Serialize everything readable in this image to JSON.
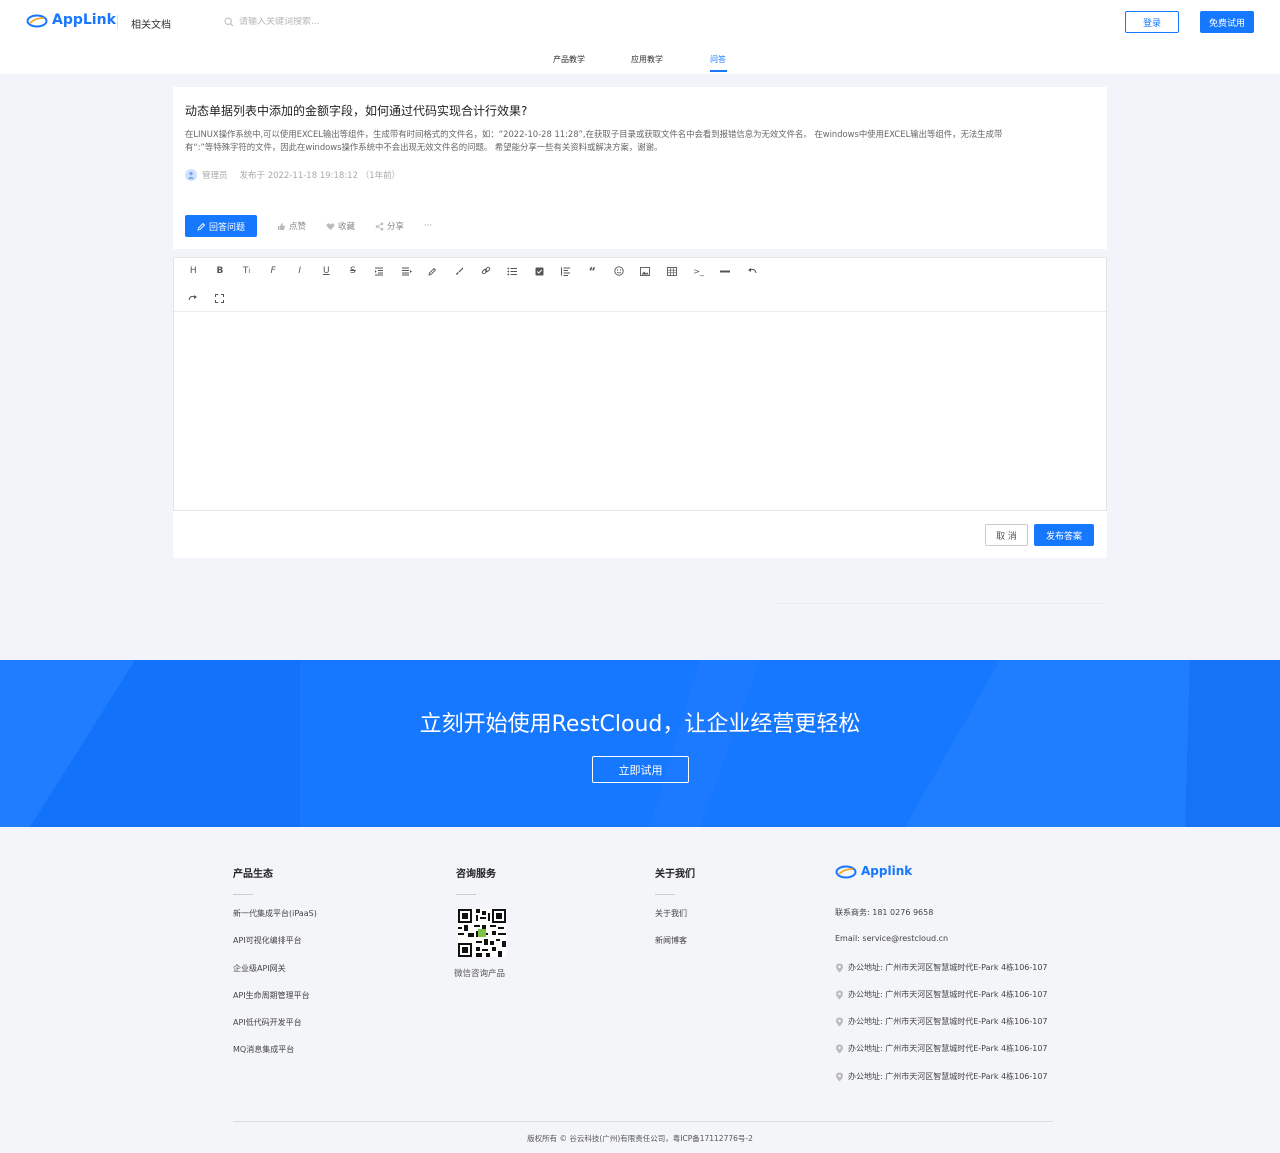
{
  "header": {
    "brand": "AppLink",
    "docs_label": "相关文档",
    "search_placeholder": "请输入关键词搜索...",
    "login_label": "登录",
    "trial_label": "免费试用",
    "accent": "#1677ff"
  },
  "tabs": [
    {
      "label": "产品教学"
    },
    {
      "label": "应用教学"
    },
    {
      "label": "问答",
      "active": true
    }
  ],
  "question": {
    "title": "动态单据列表中添加的金额字段，如何通过代码实现合计行效果?",
    "body_line1": "在LINUX操作系统中,可以使用EXCEL输出等组件，生成带有时间格式的文件名，如：“2022-10-28 11:28”,在获取子目录或获取文件名中会看到报错信息为无效文件名。 在windows中使用EXCEL输出等组件，无法生成带",
    "body_line2": "有“:”等特殊字符的文件，因此在windows操作系统中不会出现无效文件名的问题。 希望能分享一些有关资料或解决方案，谢谢。",
    "author": "管理员",
    "posted": "发布于 2022-11-18 19:18:12 （1年前）",
    "answer_label": "回答问题",
    "like_label": "点赞",
    "fav_label": "收藏",
    "share_label": "分享",
    "more_label": "···"
  },
  "editor": {
    "toolbar_row1": [
      "H",
      "B",
      "TI",
      "F",
      "I",
      "U",
      "S",
      "indent",
      "align",
      "pen",
      "brush",
      "link",
      "list",
      "check",
      "list-left",
      "quote",
      "emoji",
      "image",
      "table",
      "code",
      "hr",
      "undo"
    ],
    "toolbar_row2": [
      "redo",
      "fullscreen"
    ],
    "cancel_label": "取 消",
    "publish_label": "发布答案"
  },
  "banner": {
    "title": "立刻开始使用RestCloud，让企业经营更轻松",
    "button_label": "立即试用"
  },
  "footer": {
    "col1": {
      "title": "产品生态",
      "items": [
        "新一代集成平台(iPaaS)",
        "API可视化编排平台",
        "企业级API网关",
        "API生命周期管理平台",
        "API低代码开发平台",
        "MQ消息集成平台"
      ]
    },
    "col2": {
      "title": "咨询服务",
      "qr_caption": "微信咨询产品"
    },
    "col3": {
      "title": "关于我们",
      "items": [
        "关于我们",
        "新闻博客"
      ]
    },
    "col4": {
      "brand": "Applink",
      "phone": "联系商务: 181 0276 9658",
      "email": "Email: service@restcloud.cn",
      "addresses": [
        "办公地址: 广州市天河区智慧城时代E-Park 4栋106-107",
        "办公地址: 广州市天河区智慧城时代E-Park 4栋106-107",
        "办公地址: 广州市天河区智慧城时代E-Park 4栋106-107",
        "办公地址: 广州市天河区智慧城时代E-Park 4栋106-107",
        "办公地址: 广州市天河区智慧城时代E-Park 4栋106-107"
      ]
    },
    "copyright": "版权所有 © 谷云科技(广州)有限责任公司，粤ICP备17112776号-2"
  }
}
